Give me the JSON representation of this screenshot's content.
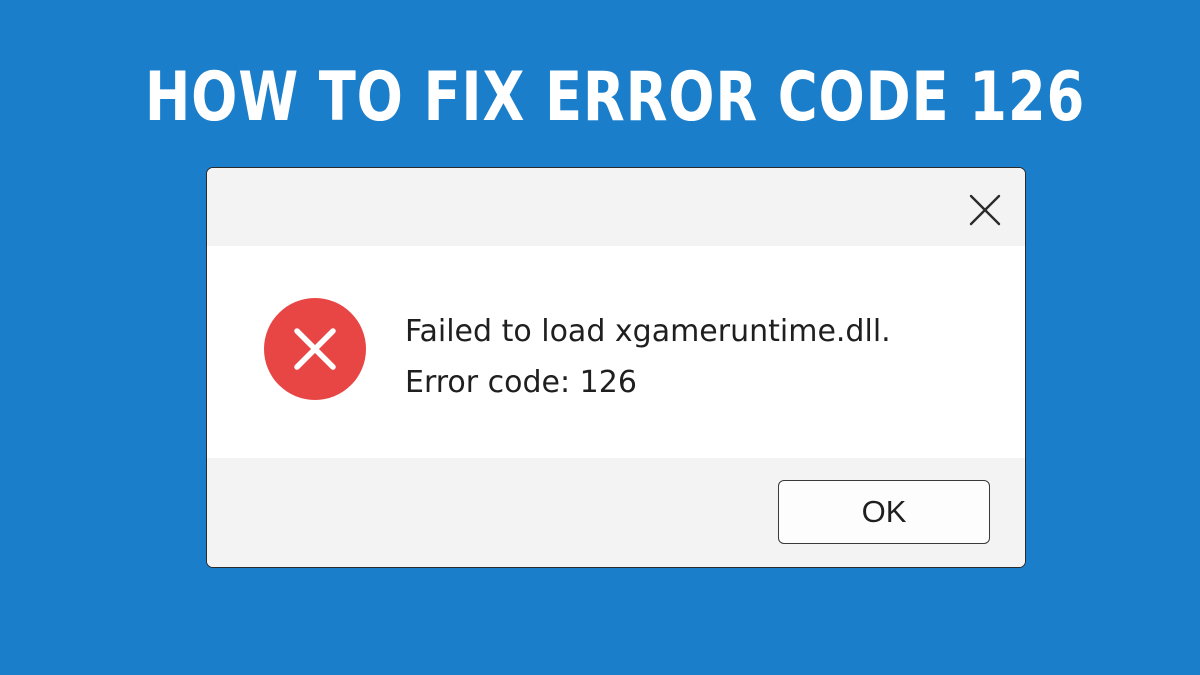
{
  "headline": "HOW TO FIX ERROR CODE 126",
  "dialog": {
    "close_icon": "close-icon",
    "status_icon": "error-x-icon",
    "message_line1": "Failed to load xgameruntime.dll.",
    "message_line2": "Error code: 126",
    "ok_label": "OK"
  },
  "colors": {
    "background": "#1b7ecb",
    "headline_text": "#ffffff",
    "error_icon": "#e84545",
    "dialog_body": "#ffffff",
    "dialog_chrome": "#f3f3f3"
  }
}
